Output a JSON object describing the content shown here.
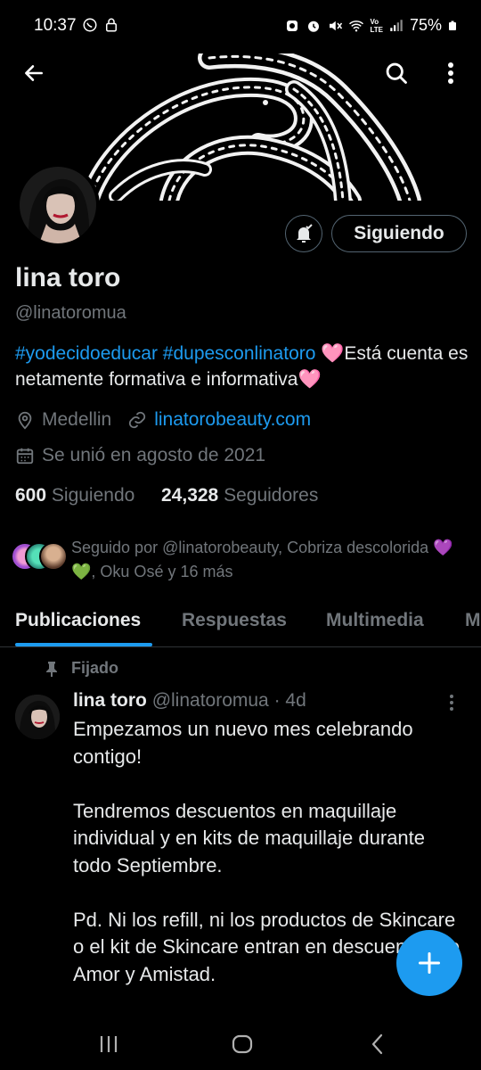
{
  "status_bar": {
    "time": "10:37",
    "battery": "75%",
    "network_label_top": "Vo",
    "network_label_bottom": "LTE"
  },
  "profile": {
    "name": "lina toro",
    "handle": "@linatoromua",
    "bio_tags": "#yodecidoeducar #dupesconlinatoro",
    "bio_heart_1": "🩷",
    "bio_text_1": "Está cuenta es netamente formativa e informativa",
    "bio_heart_2": "🩷",
    "location": "Medellin",
    "website": "linatorobeauty.com",
    "joined": "Se unió en agosto de 2021",
    "following_count": "600",
    "following_label": "Siguiendo",
    "followers_count": "24,328",
    "followers_label": "Seguidores",
    "followed_by_1": "Seguido por @linatorobeauty, Cobriza descolorida ",
    "followed_by_emoji": "💜💚",
    "followed_by_2": ", Oku Osé y 16 más"
  },
  "actions": {
    "follow_button": "Siguiendo"
  },
  "tabs": [
    {
      "label": "Publicaciones",
      "active": true
    },
    {
      "label": "Respuestas",
      "active": false
    },
    {
      "label": "Multimedia",
      "active": false
    },
    {
      "label": "M",
      "active": false
    }
  ],
  "pinned_post": {
    "pinned_label": "Fijado",
    "author": "lina toro",
    "handle": "@linatoromua",
    "separator": "·",
    "age": "4d",
    "paragraphs": [
      "Empezamos un nuevo mes celebrando contigo!",
      "Tendremos descuentos en maquillaje individual y en kits de maquillaje durante todo Septiembre.",
      "Pd. Ni los refill, ni los productos de Skincare o el kit de Skincare entran en descuentos de Amor y Amistad."
    ]
  },
  "colors": {
    "accent": "#1d9bf0",
    "muted": "#71767b",
    "text": "#e7e9ea",
    "background": "#000000",
    "border": "#2f3336"
  }
}
